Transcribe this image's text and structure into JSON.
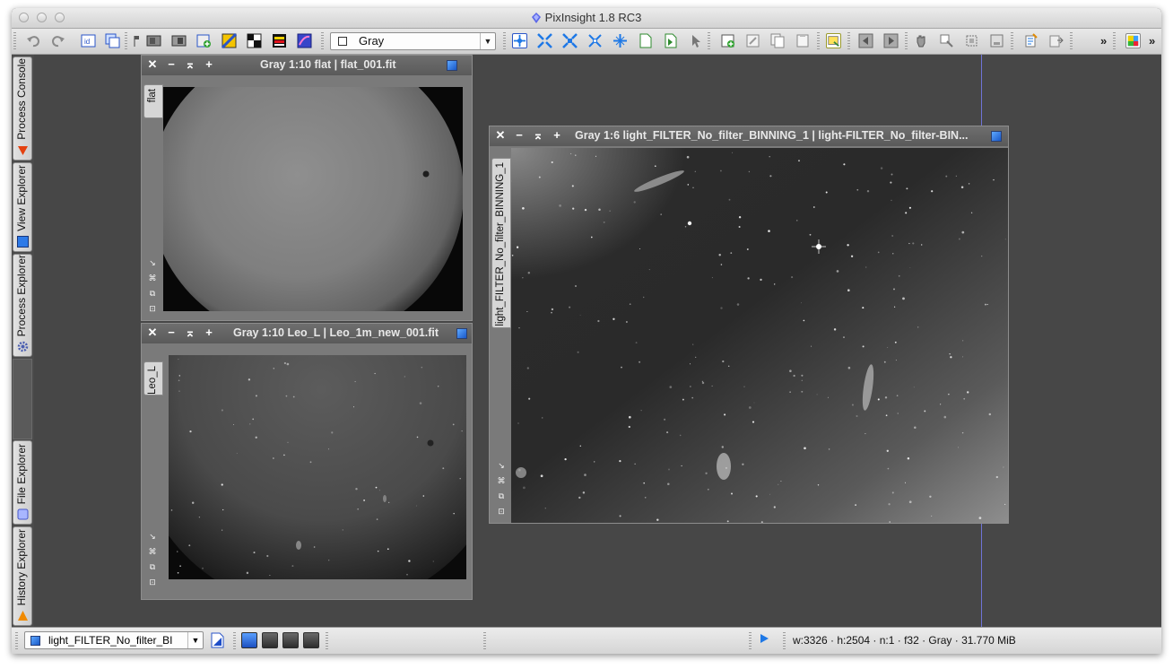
{
  "app": {
    "title": "PixInsight 1.8 RC3"
  },
  "toolbar": {
    "view_mode_value": "Gray",
    "overflow_label": "»"
  },
  "left_dock": {
    "tabs": [
      {
        "label": "Process Console",
        "icon": "process-console-icon"
      },
      {
        "label": "View Explorer",
        "icon": "view-explorer-icon"
      },
      {
        "label": "Process Explorer",
        "icon": "process-explorer-icon"
      },
      {
        "label": "File Explorer",
        "icon": "file-explorer-icon"
      },
      {
        "label": "History Explorer",
        "icon": "history-explorer-icon"
      }
    ]
  },
  "windows": {
    "flat": {
      "title": "Gray 1:10 flat | flat_001.fit",
      "view_tab": "flat"
    },
    "leo": {
      "title": "Gray 1:10 Leo_L | Leo_1m_new_001.fit",
      "view_tab": "Leo_L"
    },
    "light": {
      "title": "Gray 1:6 light_FILTER_No_filter_BINNING_1 | light-FILTER_No_filter-BIN...",
      "view_tab": "light_FILTER_No_filter_BINNING_1"
    }
  },
  "status_bar": {
    "current_view": "light_FILTER_No_filter_BI",
    "info": "w:3326 · h:2504 · n:1 · f32 · Gray · 31.770 MiB"
  },
  "colors": {
    "accent_blue": "#1e78e6",
    "workspace_bg": "#474747",
    "guide_line": "#6f74d6"
  }
}
